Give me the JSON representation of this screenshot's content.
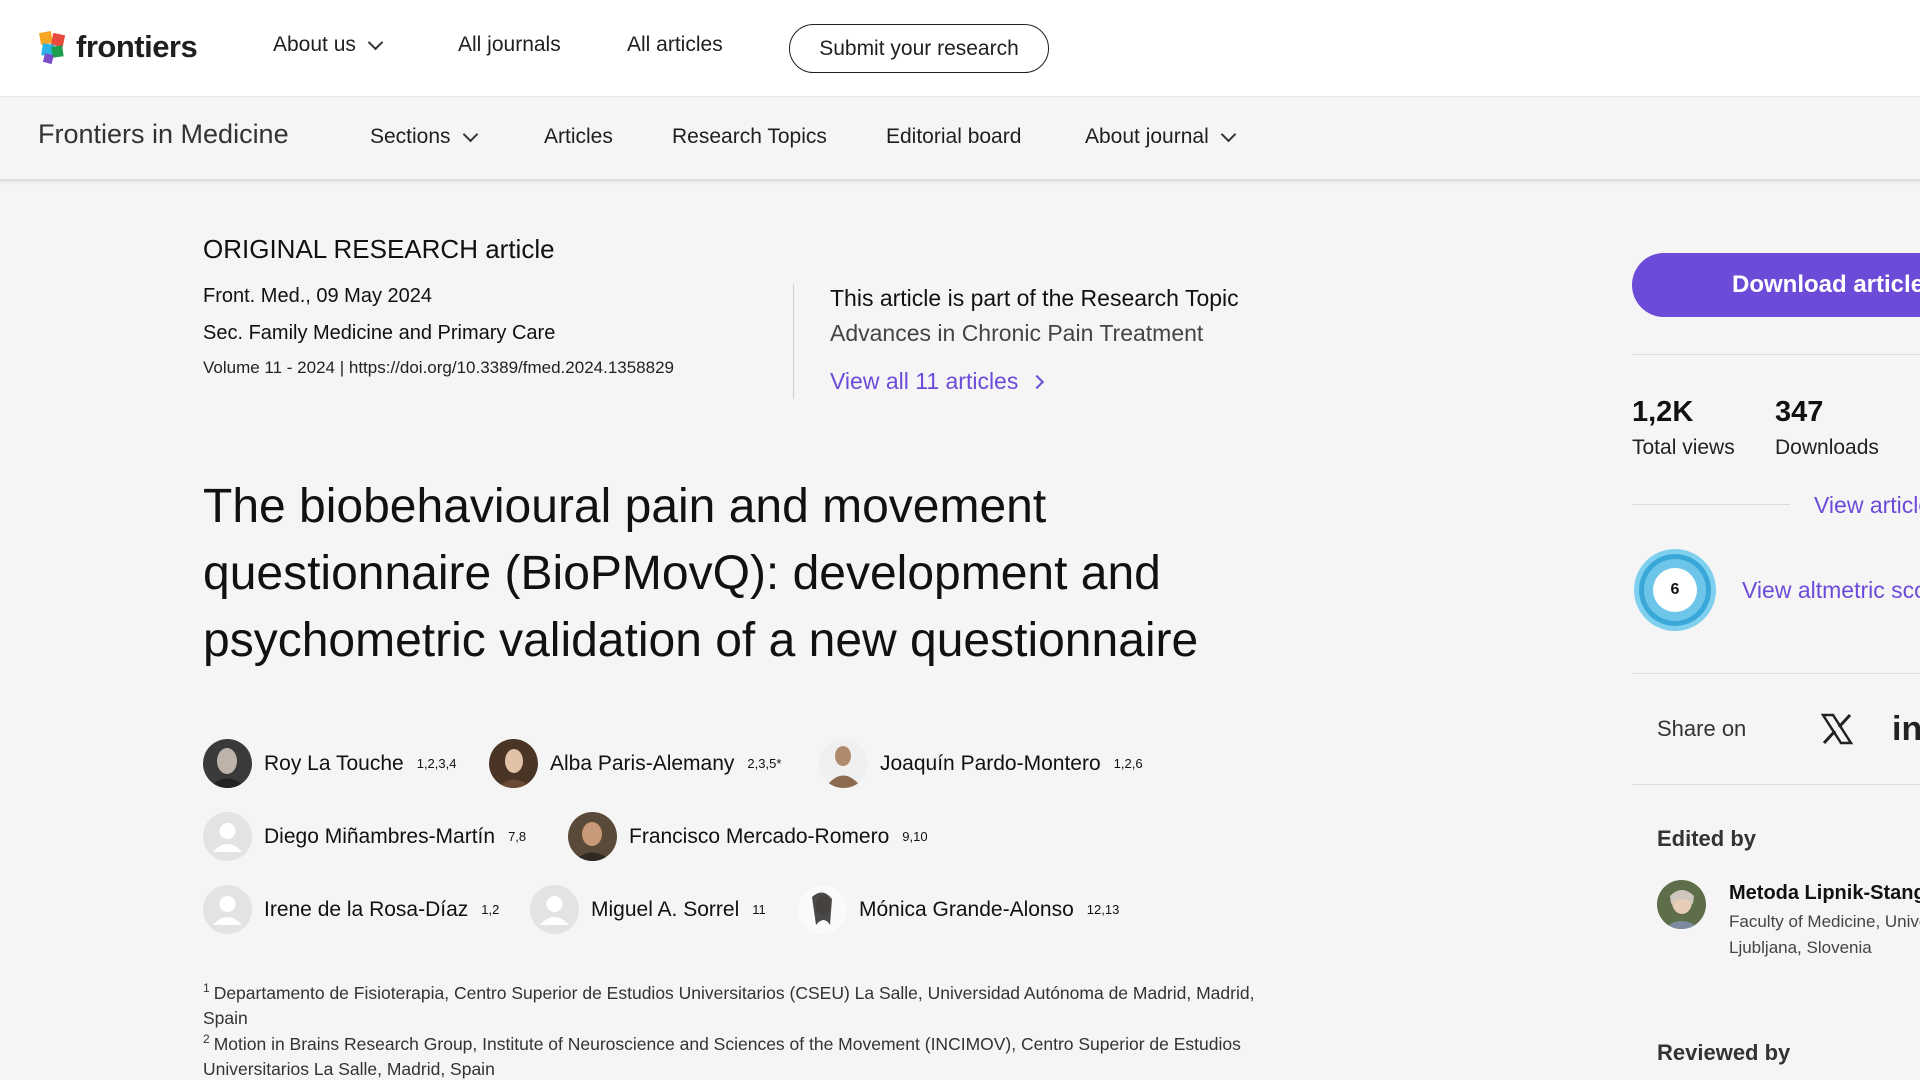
{
  "topnav": {
    "logo_text": "frontiers",
    "items": [
      {
        "label": "About us",
        "has_dropdown": true
      },
      {
        "label": "All journals",
        "has_dropdown": false
      },
      {
        "label": "All articles",
        "has_dropdown": false
      }
    ],
    "submit_label": "Submit your research"
  },
  "journal_nav": {
    "title": "Frontiers in Medicine",
    "items": [
      {
        "label": "Sections",
        "has_dropdown": true
      },
      {
        "label": "Articles",
        "has_dropdown": false
      },
      {
        "label": "Research Topics",
        "has_dropdown": false
      },
      {
        "label": "Editorial board",
        "has_dropdown": false
      },
      {
        "label": "About journal",
        "has_dropdown": true
      }
    ]
  },
  "article": {
    "type": "ORIGINAL RESEARCH article",
    "journal_date": "Front. Med., 09 May 2024",
    "section": "Sec. Family Medicine and Primary Care",
    "volume_doi": "Volume 11 - 2024 | https://doi.org/10.3389/fmed.2024.1358829",
    "research_topic_intro": "This article is part of the Research Topic",
    "research_topic_name": "Advances in Chronic Pain Treatment",
    "view_all_label": "View all 11 articles",
    "title": "The biobehavioural pain and movement questionnaire (BioPMovQ): development and psychometric validation of a new questionnaire",
    "authors": [
      {
        "name": "Roy La Touche",
        "sup": "1,2,3,4",
        "avatar": "photo"
      },
      {
        "name": "Alba Paris-Alemany",
        "sup": "2,3,5*",
        "avatar": "photo"
      },
      {
        "name": "Joaquín Pardo-Montero",
        "sup": "1,2,6",
        "avatar": "photo"
      },
      {
        "name": "Diego Miñambres-Martín",
        "sup": "7,8",
        "avatar": "placeholder"
      },
      {
        "name": "Francisco Mercado-Romero",
        "sup": "9,10",
        "avatar": "photo"
      },
      {
        "name": "Irene de la Rosa-Díaz",
        "sup": "1,2",
        "avatar": "placeholder"
      },
      {
        "name": "Miguel A. Sorrel",
        "sup": "11",
        "avatar": "placeholder"
      },
      {
        "name": "Mónica Grande-Alonso",
        "sup": "12,13",
        "avatar": "photo"
      }
    ],
    "affiliations": [
      {
        "num": "1",
        "text": "Departamento de Fisioterapia, Centro Superior de Estudios Universitarios (CSEU) La Salle, Universidad Autónoma de Madrid, Madrid, Spain"
      },
      {
        "num": "2",
        "text": "Motion in Brains Research Group, Institute of Neuroscience and Sciences of the Movement (INCIMOV), Centro Superior de Estudios Universitarios La Salle, Madrid, Spain"
      }
    ]
  },
  "sidebar": {
    "download_label": "Download article",
    "total_views_value": "1,2K",
    "total_views_label": "Total views",
    "downloads_value": "347",
    "downloads_label": "Downloads",
    "view_metrics_label": "View article impact",
    "altmetric_score": "6",
    "altmetric_link": "View altmetric score",
    "share_label": "Share on",
    "share_icons": [
      "x-icon",
      "linkedin-icon"
    ],
    "edited_by_label": "Edited by",
    "editor_name": "Metoda Lipnik-Stangelj",
    "editor_aff_line1": "Faculty of Medicine, University of",
    "editor_aff_line2": "Ljubljana, Slovenia",
    "reviewed_by_label": "Reviewed by",
    "accent_color": "#6c4bd9"
  }
}
